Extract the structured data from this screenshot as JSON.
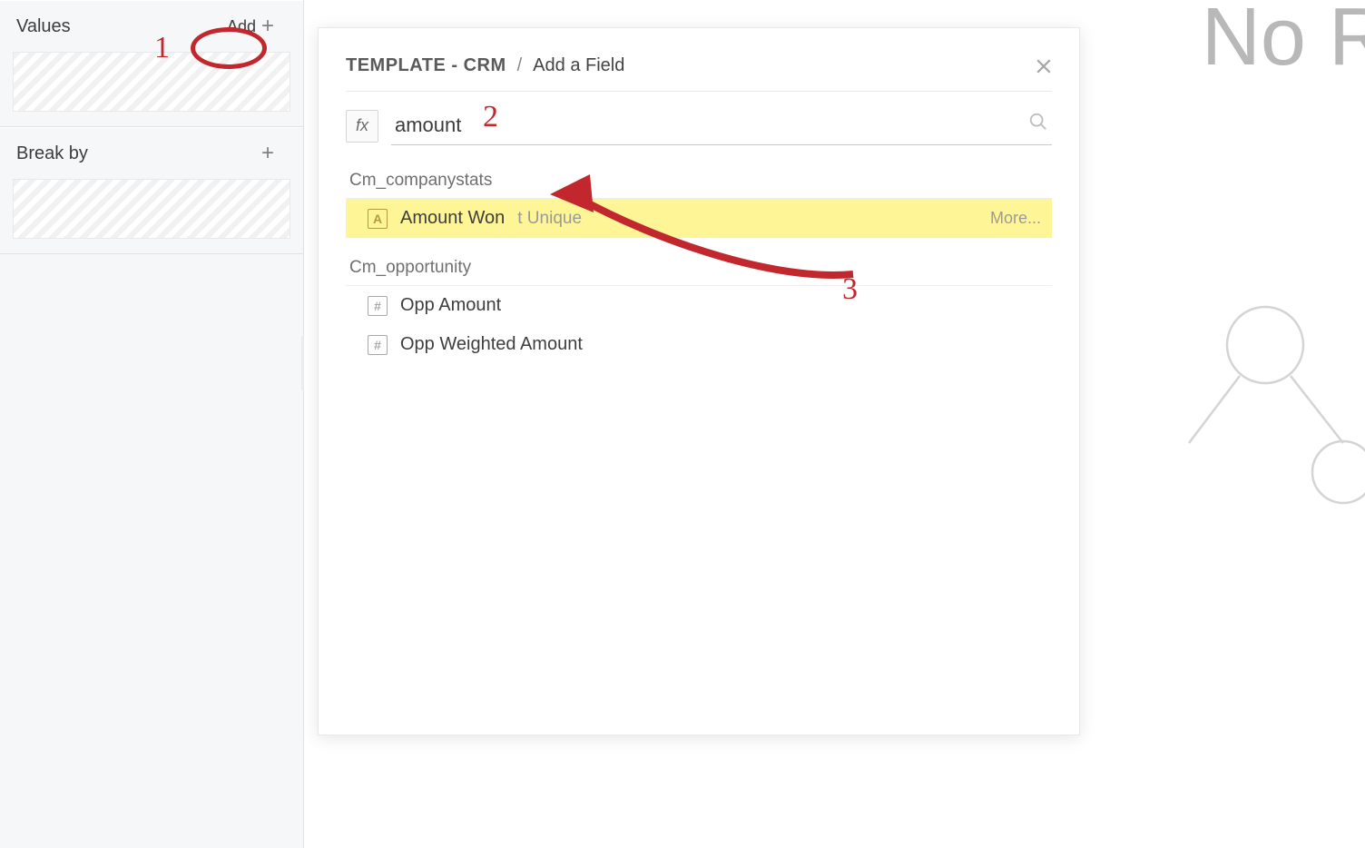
{
  "sidebar": {
    "values": {
      "title": "Values",
      "add_label": "Add"
    },
    "breakby": {
      "title": "Break by"
    }
  },
  "canvas": {
    "empty_heading": "No Res"
  },
  "modal": {
    "crumb_a": "TEMPLATE - CRM",
    "crumb_b": "Add a Field",
    "fx_label": "fx",
    "search_value": "amount",
    "groups": [
      {
        "name": "Cm_companystats",
        "items": [
          {
            "icon": "A",
            "icon_kind": "text",
            "label": "Amount Won",
            "sub": "t Unique",
            "more": "More...",
            "highlight": true
          }
        ]
      },
      {
        "name": "Cm_opportunity",
        "items": [
          {
            "icon": "#",
            "icon_kind": "num",
            "label": "Opp Amount"
          },
          {
            "icon": "#",
            "icon_kind": "num",
            "label": "Opp Weighted Amount"
          }
        ]
      }
    ]
  },
  "annotations": {
    "n1": "1",
    "n2": "2",
    "n3": "3"
  }
}
